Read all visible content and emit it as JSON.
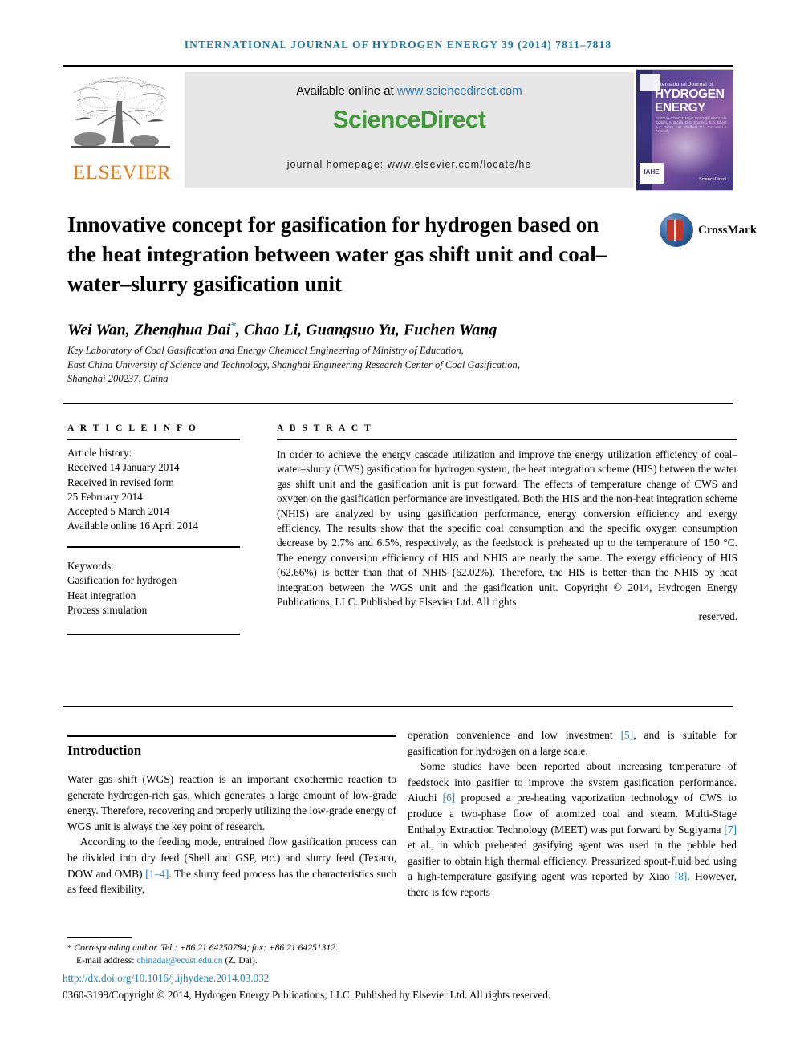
{
  "running_head": "INTERNATIONAL JOURNAL OF HYDROGEN ENERGY 39 (2014) 7811–7818",
  "masthead": {
    "publisher_logo_text": "ELSEVIER",
    "available_prefix": "Available online at ",
    "available_url": "www.sciencedirect.com",
    "sciencedirect_logo": "ScienceDirect",
    "journal_homepage": "journal homepage: www.elsevier.com/locate/he",
    "cover": {
      "line1": "International Journal of",
      "line2": "HYDROGEN",
      "line3": "ENERGY",
      "editors": "Editor-in-Chief: T. Nejat Veziroğlu   Associate Editors: A. Bicelli, D.G. Frumkin, S.A. Sherif, A.C. Dillon, J.W. Sheffield, D.L. Cox and I.A. Aminally",
      "society_mark": "IAHE",
      "sd_mark": "ScienceDirect"
    }
  },
  "article": {
    "title": "Innovative concept for gasification for hydrogen based on the heat integration between water gas shift unit and coal–water–slurry gasification unit",
    "crossmark_label": "CrossMark",
    "authors": "Wei Wan, Zhenghua Dai",
    "authors_corresponding_mark": "*",
    "authors_rest": ", Chao Li, Guangsuo Yu, Fuchen Wang",
    "affiliation_line1": "Key Laboratory of Coal Gasification and Energy Chemical Engineering of Ministry of Education,",
    "affiliation_line2": "East China University of Science and Technology, Shanghai Engineering Research Center of Coal Gasification,",
    "affiliation_line3": "Shanghai 200237, China"
  },
  "info_panel": {
    "article_info_label": "A R T I C L E   I N F O",
    "abstract_label": "A B S T R A C T",
    "history_label": "Article history:",
    "history": [
      "Received 14 January 2014",
      "Received in revised form",
      "25 February 2014",
      "Accepted 5 March 2014",
      "Available online 16 April 2014"
    ],
    "keywords_label": "Keywords:",
    "keywords": [
      "Gasification for hydrogen",
      "Heat integration",
      "Process simulation"
    ],
    "abstract_body": "In order to achieve the energy cascade utilization and improve the energy utilization efficiency of coal–water–slurry (CWS) gasification for hydrogen system, the heat integration scheme (HIS) between the water gas shift unit and the gasification unit is put forward. The effects of temperature change of CWS and oxygen on the gasification performance are investigated. Both the HIS and the non-heat integration scheme (NHIS) are analyzed by using gasification performance, energy conversion efficiency and exergy efficiency. The results show that the specific coal consumption and the specific oxygen consumption decrease by 2.7% and 6.5%, respectively, as the feedstock is preheated up to the temperature of 150 °C. The energy conversion efficiency of HIS and NHIS are nearly the same. The exergy efficiency of HIS (62.66%) is better than that of NHIS (62.02%). Therefore, the HIS is better than the NHIS by heat integration between the WGS unit and the gasification unit.",
    "abstract_copyright": "Copyright © 2014, Hydrogen Energy Publications, LLC. Published by Elsevier Ltd. All rights",
    "abstract_copyright_last": "reserved."
  },
  "body": {
    "section_heading": "Introduction",
    "left_paragraph_1": "Water gas shift (WGS) reaction is an important exothermic reaction to generate hydrogen-rich gas, which generates a large amount of low-grade energy. Therefore, recovering and properly utilizing the low-grade energy of WGS unit is always the key point of research.",
    "left_paragraph_2_a": "According to the feeding mode, entrained flow gasification process can be divided into dry feed (Shell and GSP, etc.) and slurry feed (Texaco, DOW and OMB) ",
    "left_citation_1": "[1–4]",
    "left_paragraph_2_b": ". The slurry feed process has the characteristics such as feed flexibility,",
    "right_paragraph_1_a": "operation convenience and low investment ",
    "right_citation_1": "[5]",
    "right_paragraph_1_b": ", and is suitable for gasification for hydrogen on a large scale.",
    "right_paragraph_2_a": "Some studies have been reported about increasing temperature of feedstock into gasifier to improve the system gasification performance. Aiuchi ",
    "right_citation_2": "[6]",
    "right_paragraph_2_b": " proposed a pre-heating vaporization technology of CWS to produce a two-phase flow of atomized coal and steam. Multi-Stage Enthalpy Extraction Technology (MEET) was put forward by Sugiyama ",
    "right_citation_3": "[7]",
    "right_paragraph_2_c": " et al., in which preheated gasifying agent was used in the pebble bed gasifier to obtain high thermal efficiency. Pressurized spout-fluid bed using a high-temperature gasifying agent was reported by Xiao ",
    "right_citation_4": "[8]",
    "right_paragraph_2_d": ". However, there is few reports"
  },
  "footer": {
    "corresponding_mark": "*",
    "corresponding_text": "Corresponding author. Tel.: +86 21 64250784; fax: +86 21 64251312.",
    "email_label": "E-mail address: ",
    "email": "chinadai@ecust.edu.cn",
    "email_suffix": " (Z. Dai).",
    "doi": "http://dx.doi.org/10.1016/j.ijhydene.2014.03.032",
    "copyright": "0360-3199/Copyright © 2014, Hydrogen Energy Publications, LLC. Published by Elsevier Ltd. All rights reserved."
  },
  "colors": {
    "link": "#1f7fb5",
    "running_head": "#1379a7",
    "elsevier_orange": "#e87d1e",
    "sciencedirect_green": "#3d9c35"
  }
}
